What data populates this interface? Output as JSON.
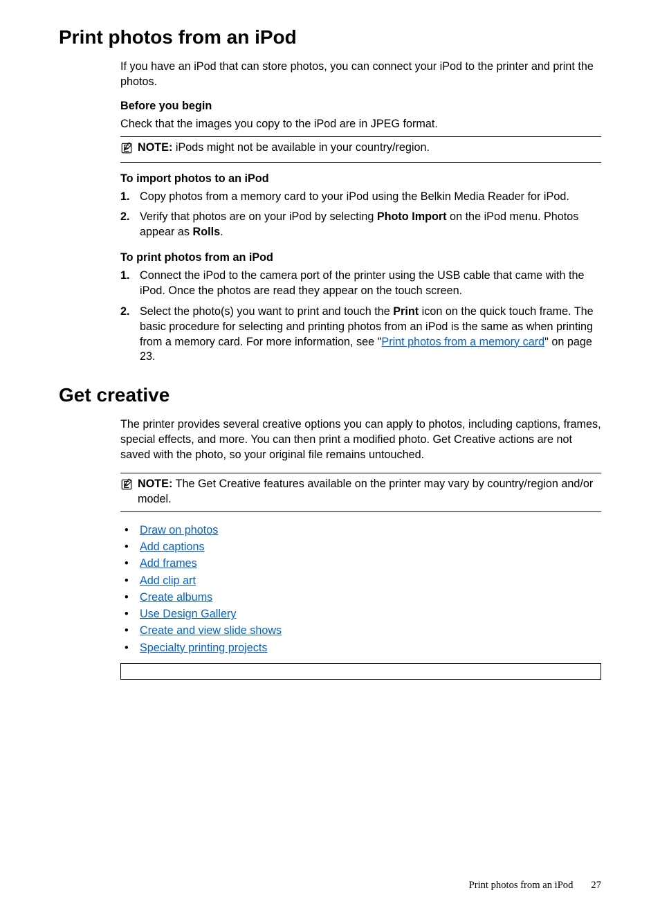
{
  "h1_1": "Print photos from an iPod",
  "intro_1": "If you have an iPod that can store photos, you can connect your iPod to the printer and print the photos.",
  "sub_before": "Before you begin",
  "before_p": "Check that the images you copy to the iPod are in JPEG format.",
  "note1": {
    "label": "NOTE:",
    "text": "iPods might not be available in your country/region."
  },
  "sub_import": "To import photos to an iPod",
  "ol_import": [
    {
      "text": "Copy photos from a memory card to your iPod using the Belkin Media Reader for iPod."
    },
    {
      "pre": "Verify that photos are on your iPod by selecting ",
      "bold1": "Photo Import",
      "mid": " on the iPod menu. Photos appear as ",
      "bold2": "Rolls",
      "post": "."
    }
  ],
  "sub_print": "To print photos from an iPod",
  "ol_print": [
    {
      "text": "Connect the iPod to the camera port of the printer using the USB cable that came with the iPod. Once the photos are read they appear on the touch screen."
    },
    {
      "pre": "Select the photo(s) you want to print and touch the ",
      "bold1": "Print",
      "post1": " icon on the quick touch frame. The basic procedure for selecting and printing photos from an iPod is the same as when printing from a memory card. For more information, see ",
      "linkpre": "\"",
      "link": "Print photos from a memory card",
      "linkpost": "\"",
      "tail": " on page 23."
    }
  ],
  "h1_2": "Get creative",
  "intro_2": "The printer provides several creative options you can apply to photos, including captions, frames, special effects, and more. You can then print a modified photo. Get Creative actions are not saved with the photo, so your original file remains untouched.",
  "note2": {
    "label": "NOTE:",
    "text": "The Get Creative features available on the printer may vary by country/region and/or model."
  },
  "toc": [
    "Draw on photos",
    "Add captions",
    "Add frames",
    "Add clip art",
    "Create albums",
    "Use Design Gallery",
    "Create and view slide shows",
    "Specialty printing projects"
  ],
  "footer": {
    "section": "Print photos from an iPod",
    "page": "27"
  }
}
